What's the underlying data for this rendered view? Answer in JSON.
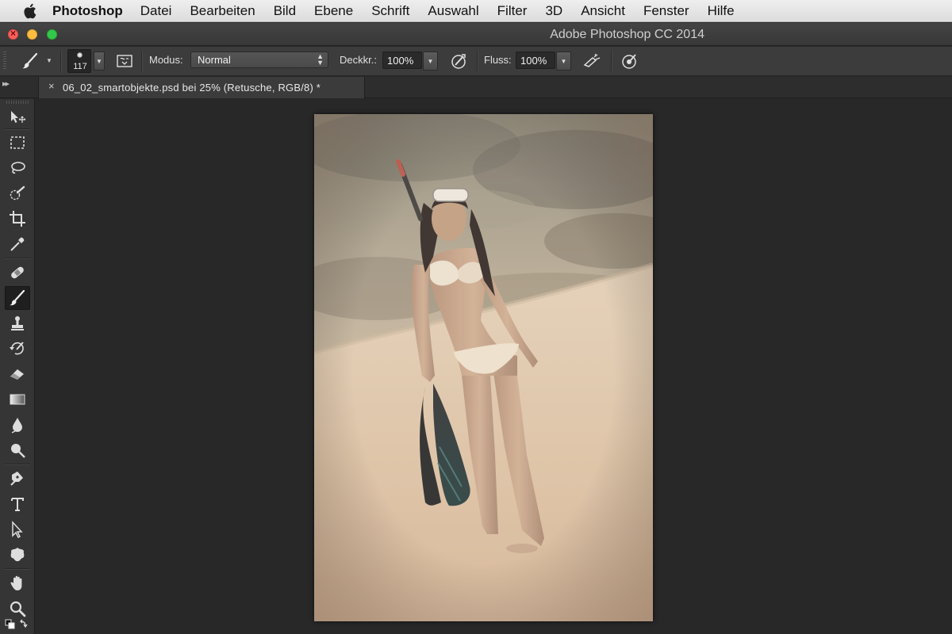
{
  "menubar": {
    "app": "Photoshop",
    "items": [
      "Datei",
      "Bearbeiten",
      "Bild",
      "Ebene",
      "Schrift",
      "Auswahl",
      "Filter",
      "3D",
      "Ansicht",
      "Fenster",
      "Hilfe"
    ]
  },
  "window": {
    "title": "Adobe Photoshop CC 2014"
  },
  "options": {
    "brush_size": "117",
    "mode_label": "Modus:",
    "mode_value": "Normal",
    "opacity_label": "Deckkr.:",
    "opacity_value": "100%",
    "flow_label": "Fluss:",
    "flow_value": "100%"
  },
  "document": {
    "tab_label": "06_02_smartobjekte.psd bei 25% (Retusche, RGB/8) *",
    "zoom_percent": 25,
    "layer": "Retusche",
    "color_mode": "RGB/8"
  },
  "tools": [
    {
      "name": "move-tool",
      "icon": "move-icon"
    },
    {
      "name": "marquee-tool",
      "icon": "rect-marquee-icon"
    },
    {
      "name": "lasso-tool",
      "icon": "lasso-icon"
    },
    {
      "name": "quick-selection-tool",
      "icon": "quick-select-icon"
    },
    {
      "name": "crop-tool",
      "icon": "crop-icon"
    },
    {
      "name": "eyedropper-tool",
      "icon": "eyedropper-icon"
    },
    {
      "name": "healing-brush-tool",
      "icon": "bandage-icon"
    },
    {
      "name": "brush-tool",
      "icon": "brush-icon",
      "active": true
    },
    {
      "name": "clone-stamp-tool",
      "icon": "stamp-icon"
    },
    {
      "name": "history-brush-tool",
      "icon": "history-brush-icon"
    },
    {
      "name": "eraser-tool",
      "icon": "eraser-icon"
    },
    {
      "name": "gradient-tool",
      "icon": "gradient-icon"
    },
    {
      "name": "blur-tool",
      "icon": "blur-drop-icon"
    },
    {
      "name": "dodge-tool",
      "icon": "dodge-icon"
    },
    {
      "name": "pen-tool",
      "icon": "pen-icon"
    },
    {
      "name": "type-tool",
      "icon": "type-icon"
    },
    {
      "name": "path-selection-tool",
      "icon": "path-select-icon"
    },
    {
      "name": "shape-tool",
      "icon": "custom-shape-icon"
    },
    {
      "name": "hand-tool",
      "icon": "hand-icon"
    },
    {
      "name": "zoom-tool",
      "icon": "zoom-icon"
    }
  ],
  "colors": {
    "ui_bg": "#282828",
    "panel": "#353535",
    "options": "#3c3c3c",
    "close": "#fc605c",
    "minimize": "#fdbc40",
    "maximize": "#34c84a"
  }
}
